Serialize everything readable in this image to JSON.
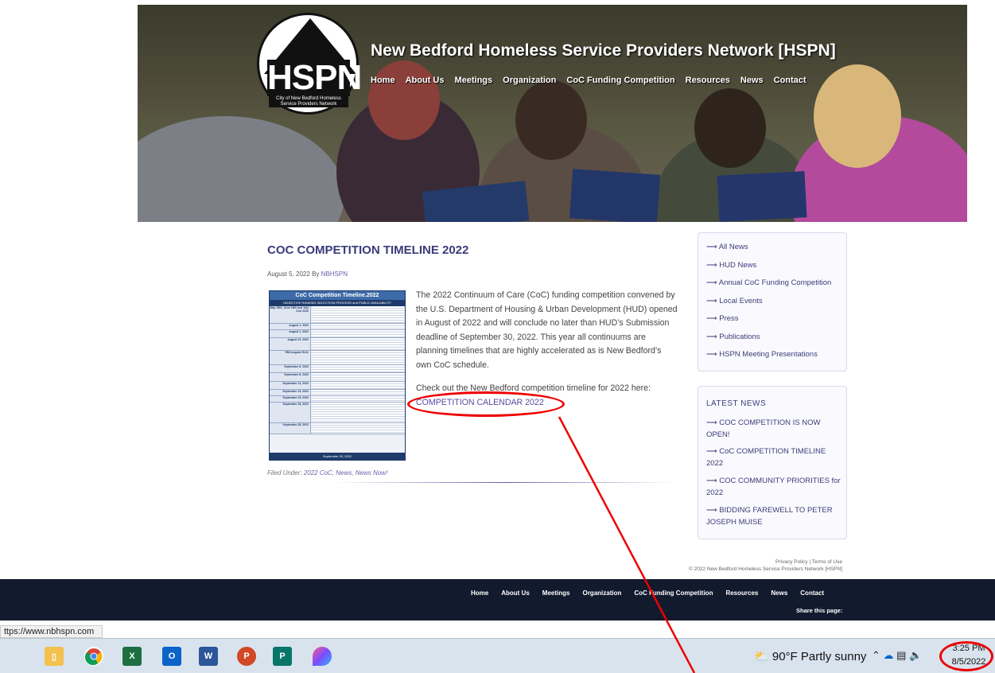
{
  "header": {
    "site_title": "New Bedford Homeless Service Providers Network [HSPN]",
    "logo_text": "HSPN",
    "logo_subtext": "City of New Bedford Homeless Service Providers Network",
    "nav": [
      "Home",
      "About Us",
      "Meetings",
      "Organization",
      "CoC Funding Competition",
      "Resources",
      "News",
      "Contact"
    ]
  },
  "article": {
    "title": "COC COMPETITION TIMELINE 2022",
    "date": "August 5, 2022",
    "by": "By",
    "author": "NBHSPN",
    "image": {
      "title": "CoC Competition Timeline.2022",
      "subtitle": "OBJECTIVE RANKING SELECTION PROCESS and PUBLIC AVAILABILITY",
      "rows": [
        "May 19th, June 16th and July 21st 2022",
        "August 1, 2022",
        "August 1, 2022",
        "August 22, 2022",
        "TBD August 25-31",
        "September 6, 2022",
        "September 8, 2022",
        "September 12, 2022",
        "September 19, 2022",
        "September 23, 2022",
        "September 26, 2022",
        "September 28, 2022"
      ],
      "footer": "September 30, 2022"
    },
    "body": "The 2022 Continuum of Care (CoC) funding competition convened by the U.S. Department of Housing & Urban Development (HUD) opened in August of 2022 and will conclude no later than HUD’s Submission deadline of September 30, 2022.  This year all continuums are planning timelines that are highly accelerated as is New Bedford’s own CoC schedule.",
    "check_text": "Check out the New Bedford competition timeline for 2022 here:",
    "link": "COMPETITION CALENDAR 2022",
    "filed_label": "Filed Under:",
    "filed_links": "2022 CoC, News, News Now!"
  },
  "sidebar": {
    "categories": [
      "All News",
      "HUD News",
      "Annual CoC Funding Competition",
      "Local Events",
      "Press",
      "Publications",
      "HSPN Meeting Presentations"
    ],
    "latest_title": "LATEST NEWS",
    "latest": [
      "COC COMPETITION IS NOW OPEN!",
      "CoC COMPETITION TIMELINE 2022",
      "COC COMMUNITY PRIORITIES for 2022",
      "BIDDING FAREWELL TO PETER JOSEPH MUISE"
    ]
  },
  "legal": {
    "privacy": "Privacy Policy",
    "terms": "Terms of Use",
    "copyright": "© 2022 New Bedford Homeless Service Providers Network [HSPN]"
  },
  "footer": {
    "nav": [
      "Home",
      "About Us",
      "Meetings",
      "Organization",
      "CoC Funding Competition",
      "Resources",
      "News",
      "Contact"
    ],
    "share": "Share this page:"
  },
  "status_url": "ttps://www.nbhspn.com",
  "taskbar": {
    "apps": [
      "file-explorer-icon",
      "chrome-icon",
      "excel-icon",
      "outlook-icon",
      "word-icon",
      "powerpoint-icon",
      "publisher-icon",
      "paint-icon"
    ],
    "weather": "90°F  Partly sunny",
    "time": "3:25 PM",
    "date": "8/5/2022"
  },
  "colors": {
    "accent": "#3b3b7a",
    "footer_bg": "#121a2e",
    "annotation": "#e00000"
  }
}
